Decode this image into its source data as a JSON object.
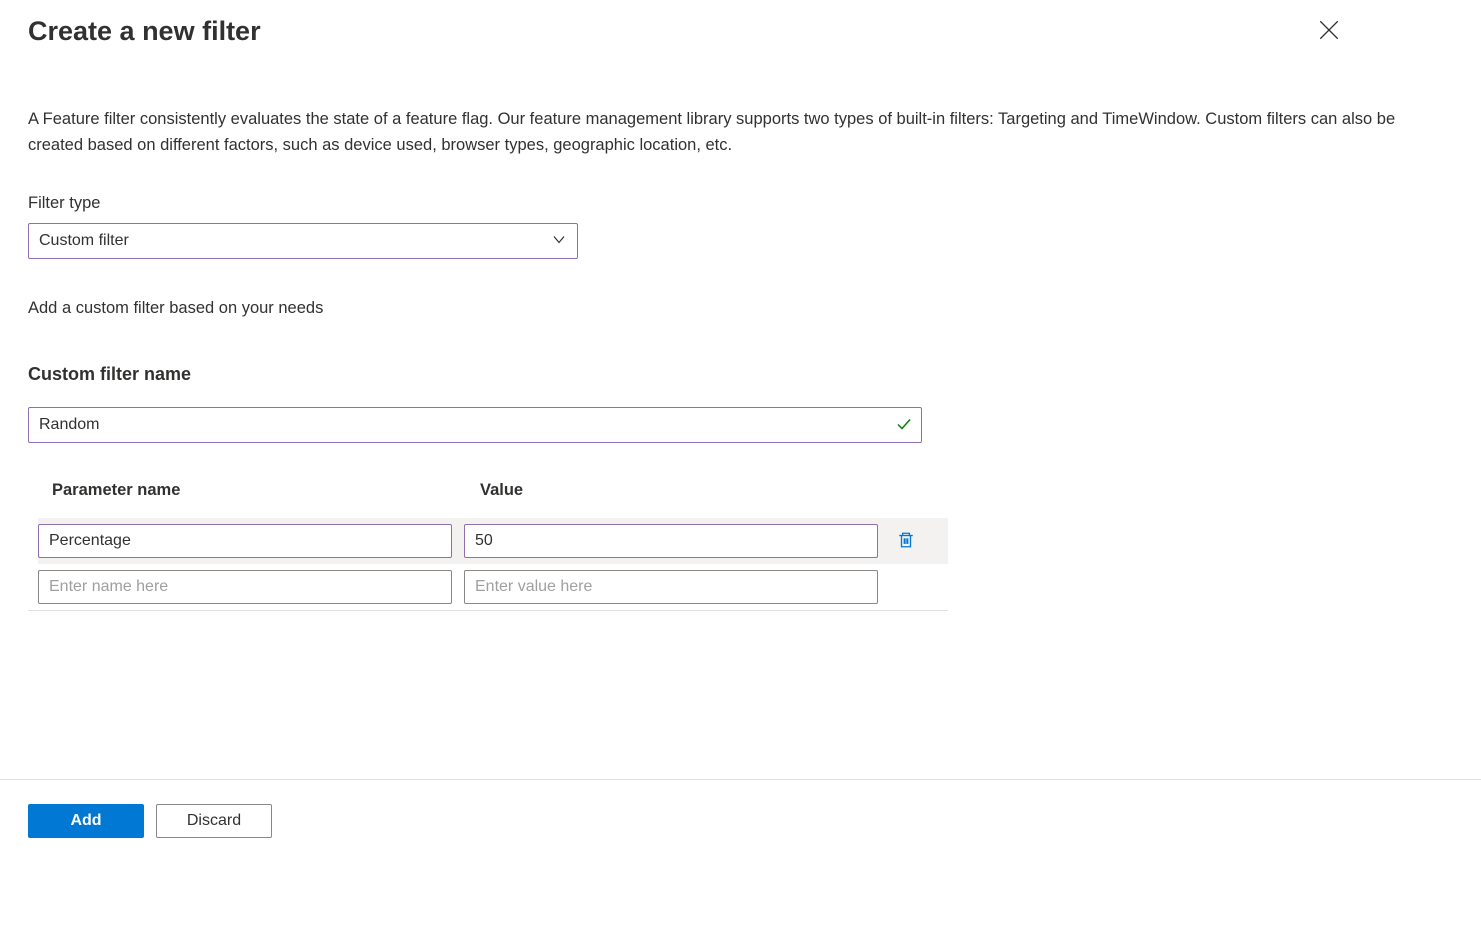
{
  "header": {
    "title": "Create a new filter"
  },
  "description": "A Feature filter consistently evaluates the state of a feature flag. Our feature management library supports two types of built-in filters: Targeting and TimeWindow. Custom filters can also be created based on different factors, such as device used, browser types, geographic location, etc.",
  "filter_type": {
    "label": "Filter type",
    "selected": "Custom filter"
  },
  "subtext": "Add a custom filter based on your needs",
  "custom_filter": {
    "heading": "Custom filter name",
    "value": "Random"
  },
  "params": {
    "header_name": "Parameter name",
    "header_value": "Value",
    "rows": [
      {
        "name": "Percentage",
        "value": "50"
      }
    ],
    "empty_row": {
      "name_placeholder": "Enter name here",
      "value_placeholder": "Enter value here"
    }
  },
  "footer": {
    "add": "Add",
    "discard": "Discard"
  }
}
